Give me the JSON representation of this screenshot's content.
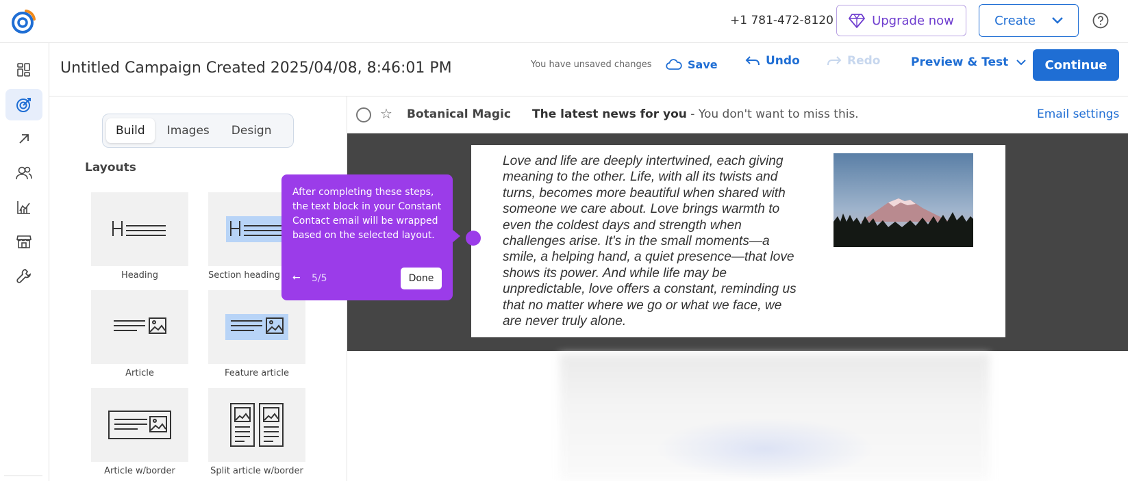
{
  "topbar": {
    "phone": "+1 781-472-8120",
    "upgrade_label": "Upgrade now",
    "create_label": "Create"
  },
  "header": {
    "campaign_title": "Untitled Campaign Created 2025/04/08, 8:46:01 PM",
    "unsaved_text": "You have unsaved changes",
    "save_label": "Save",
    "undo_label": "Undo",
    "redo_label": "Redo",
    "preview_label": "Preview & Test",
    "continue_label": "Continue"
  },
  "leftnav": {
    "items": [
      "dashboard-icon",
      "campaigns-icon",
      "outreach-icon",
      "contacts-icon",
      "reporting-icon",
      "store-icon",
      "tools-icon"
    ]
  },
  "panel": {
    "tabs": [
      "Build",
      "Images",
      "Design"
    ],
    "active_tab": "Build",
    "section_title": "Layouts",
    "layouts": [
      "Heading",
      "Section heading",
      "Article",
      "Feature article",
      "Article w/border",
      "Split article w/border"
    ]
  },
  "email": {
    "sender": "Botanical Magic",
    "subject_bold": "The latest news for you",
    "subject_rest": " - You don't want to miss this.",
    "settings_label": "Email settings",
    "body_text": "Love and life are deeply intertwined, each giving meaning to the other. Life, with all its twists and turns, becomes more beautiful when shared with someone we care about. Love brings warmth to even the coldest days and strength when challenges arise. It's in the small moments—a smile, a helping hand, a quiet presence—that love shows its power. And while life may be unpredictable, love offers a constant, reminding us that no matter where we go or what we face, we are never truly alone."
  },
  "tooltip": {
    "text": "After completing these steps, the text block in your Constant Contact email will be wrapped based on the selected layout.",
    "back_symbol": "←",
    "step": "5/5",
    "done_label": "Done"
  },
  "colors": {
    "brand_blue": "#1f6ed4",
    "tooltip_purple": "#9b3ce9",
    "upgrade_purple": "#6f3ecf"
  }
}
